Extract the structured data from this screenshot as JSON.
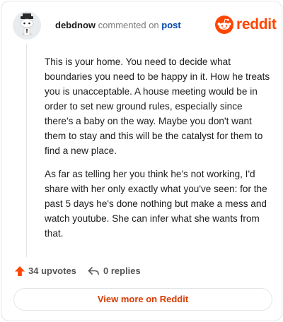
{
  "header": {
    "username": "debdnow",
    "action": "commented on",
    "post_link": "post",
    "brand": "reddit"
  },
  "comment": {
    "paragraphs": [
      "This is your home. You need to decide what boundaries you need to be happy in it. How he treats you is unacceptable. A house meeting would be in order to set new ground rules, especially since there's a baby on the way. Maybe you don't want them to stay and this will be the catalyst for them to find a new place.",
      "As far as telling her you think he's not working, I'd share with her only exactly what you've seen: for the past 5 days he's done nothing but make a mess and watch youtube. She can infer what she wants from that."
    ]
  },
  "stats": {
    "upvotes": "34 upvotes",
    "replies": "0 replies"
  },
  "footer": {
    "view_more": "View more on Reddit"
  },
  "icons": {
    "avatar": "snoo-avatar",
    "brand": "reddit-logo-icon",
    "upvote": "upvote-arrow-icon",
    "reply": "reply-icon"
  },
  "colors": {
    "brand": "#ff4500",
    "link": "#0045ac",
    "view_more": "#d93a00"
  }
}
